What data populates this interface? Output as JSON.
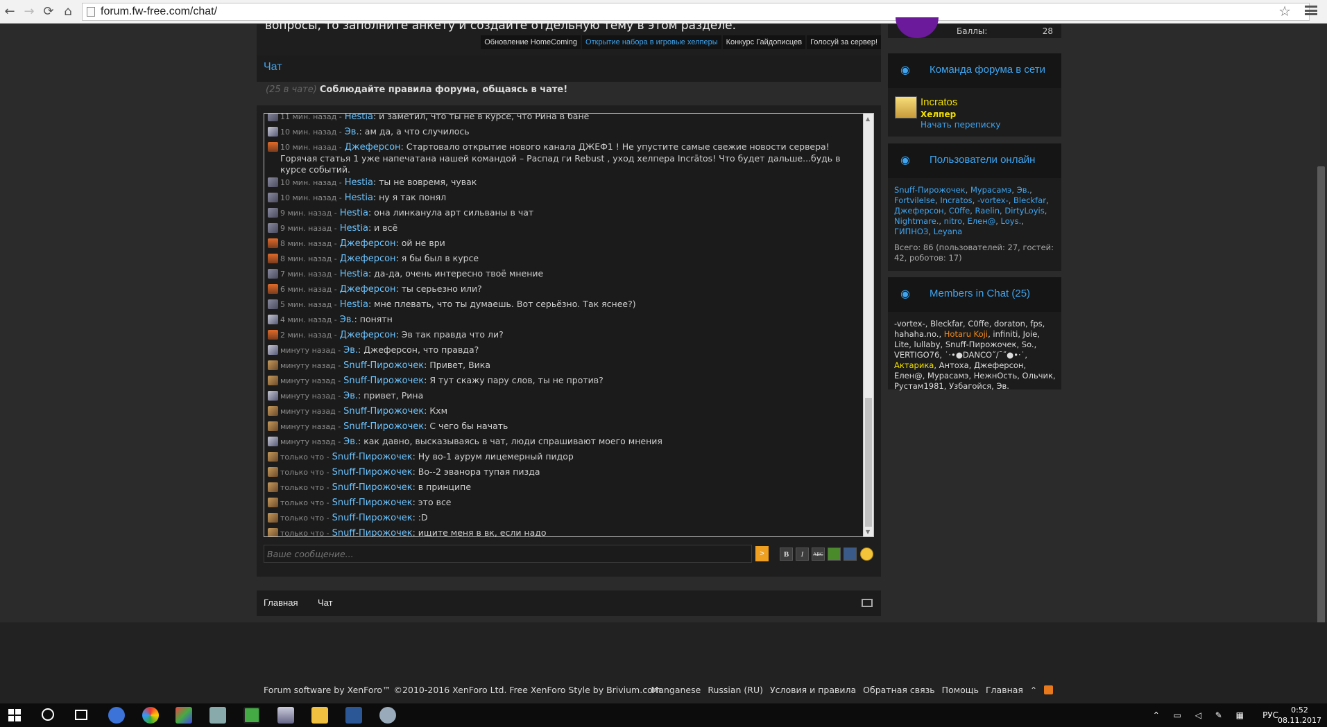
{
  "browser": {
    "url": "forum.fw-free.com/chat/"
  },
  "notices": {
    "cut_text": "вопросы, то заполните анкету и создайте отдельную тему в этом разделе.",
    "links": [
      "Обновление HomeComing",
      "Открытие набора в игровые хелперы",
      "Конкурс Гайдописцев",
      "Голосуй за сервер!"
    ]
  },
  "chat": {
    "title": "Чат",
    "count_text": "(25 в чате)",
    "rules_text": "Соблюдайте правила форума, общаясь в чате!",
    "input_placeholder": "Ваше сообщение...",
    "send_label": ">",
    "tools": [
      "B",
      "I",
      "ABC",
      "",
      "",
      ""
    ],
    "messages": [
      {
        "av": "hestia",
        "time": "11 мин. назад -",
        "author": "Hestia",
        "text": ": и заметил, что ты не в курсе, что Рина в бане"
      },
      {
        "av": "ev",
        "time": "10 мин. назад -",
        "author": "Эв.",
        "text": ": ам да, а что случилось"
      },
      {
        "av": "dj",
        "time": "10 мин. назад -",
        "author": "Джеферсон",
        "text": ": Стартовало открытие нового канала ДЖЕФ1 ! Не упустите самые свежие новости сервера! Горячая статья 1 уже напечатана нашей командой – Распад ги Rebust , уход хелпера Incrātos! Что будет дальше...будь в курсе событий."
      },
      {
        "av": "hestia",
        "time": "10 мин. назад -",
        "author": "Hestia",
        "text": ": ты не вовремя, чувак"
      },
      {
        "av": "hestia",
        "time": "10 мин. назад -",
        "author": "Hestia",
        "text": ": ну я так понял"
      },
      {
        "av": "hestia",
        "time": "9 мин. назад -",
        "author": "Hestia",
        "text": ": она линканула арт сильваны в чат"
      },
      {
        "av": "hestia",
        "time": "9 мин. назад -",
        "author": "Hestia",
        "text": ": и всё"
      },
      {
        "av": "dj",
        "time": "8 мин. назад -",
        "author": "Джеферсон",
        "text": ": ой не ври"
      },
      {
        "av": "dj",
        "time": "8 мин. назад -",
        "author": "Джеферсон",
        "text": ": я бы был в курсе"
      },
      {
        "av": "hestia",
        "time": "7 мин. назад -",
        "author": "Hestia",
        "text": ": да-да, очень интересно твоё мнение"
      },
      {
        "av": "dj",
        "time": "6 мин. назад -",
        "author": "Джеферсон",
        "text": ": ты серьезно или?"
      },
      {
        "av": "hestia",
        "time": "5 мин. назад -",
        "author": "Hestia",
        "text": ": мне плевать, что ты думаешь. Вот серьёзно. Так яснее?)"
      },
      {
        "av": "ev",
        "time": "4 мин. назад -",
        "author": "Эв.",
        "text": ": понятн"
      },
      {
        "av": "dj",
        "time": "2 мин. назад -",
        "author": "Джеферсон",
        "text": ": Эв так правда что ли?"
      },
      {
        "av": "ev",
        "time": "минуту назад -",
        "author": "Эв.",
        "text": ": Джеферсон, что правда?"
      },
      {
        "av": "sn",
        "time": "минуту назад -",
        "author": "Snuff-Пирожочек",
        "text": ": Привет, Вика"
      },
      {
        "av": "sn",
        "time": "минуту назад -",
        "author": "Snuff-Пирожочек",
        "text": ": Я тут скажу пару слов, ты не против?"
      },
      {
        "av": "ev",
        "time": "минуту назад -",
        "author": "Эв.",
        "text": ": привет, Рина"
      },
      {
        "av": "sn",
        "time": "минуту назад -",
        "author": "Snuff-Пирожочек",
        "text": ": Кхм"
      },
      {
        "av": "sn",
        "time": "минуту назад -",
        "author": "Snuff-Пирожочек",
        "text": ": С чего бы начать"
      },
      {
        "av": "ev",
        "time": "минуту назад -",
        "author": "Эв.",
        "text": ": как давно, высказываясь в чат, люди спрашивают моего мнения"
      },
      {
        "av": "sn",
        "time": "только что -",
        "author": "Snuff-Пирожочек",
        "text": ": Ну во-1 аурум лицемерный пидор"
      },
      {
        "av": "sn",
        "time": "только что -",
        "author": "Snuff-Пирожочек",
        "text": ": Во--2 эванора тупая пизда"
      },
      {
        "av": "sn",
        "time": "только что -",
        "author": "Snuff-Пирожочек",
        "text": ": в принципе"
      },
      {
        "av": "sn",
        "time": "только что -",
        "author": "Snuff-Пирожочек",
        "text": ": это все"
      },
      {
        "av": "sn",
        "time": "только что -",
        "author": "Snuff-Пирожочек",
        "text": ": :D"
      },
      {
        "av": "sn",
        "time": "только что -",
        "author": "Snuff-Пирожочек",
        "text": ": ищите меня в вк, если надо"
      }
    ]
  },
  "bottom_nav": {
    "home": "Главная",
    "chat": "Чат"
  },
  "footer": {
    "copyright": "Forum software by XenForo™ ©2010-2016 XenForo Ltd. Free XenForo Style by Brivium.com",
    "links": [
      "Manganese",
      "Russian (RU)",
      "Условия и правила",
      "Обратная связь",
      "Помощь",
      "Главная"
    ]
  },
  "sidebar": {
    "points_label": "Баллы:",
    "points_value": "28",
    "staff_title": "Команда форума в сети",
    "staff_name": "Incratos",
    "staff_role": "Хелпер",
    "staff_conv": "Начать переписку",
    "online_title": "Пользователи онлайн",
    "online_users": [
      "Snuff-Пирожочек",
      "Мурасамэ",
      "Эв.",
      "Fortvilelse",
      "Incratos",
      "-vortex-",
      "Bleckfar",
      "Джеферсон",
      "C0ffe",
      "Raelin",
      "DirtyLoyis",
      "Nightmare.",
      "nitro",
      "Елен@",
      "Loys.",
      "ГИПНОЗ",
      "Leyana"
    ],
    "online_total": "Всего: 86 (пользователей: 27, гостей: 42, роботов: 17)",
    "chat_members_title": "Members in Chat (25)",
    "chat_members": [
      {
        "n": "-vortex-",
        "c": "m"
      },
      {
        "n": "Bleckfar",
        "c": "m"
      },
      {
        "n": "C0ffe",
        "c": "m"
      },
      {
        "n": "doraton",
        "c": "m"
      },
      {
        "n": "fps",
        "c": "m"
      },
      {
        "n": "hahaha.no.",
        "c": "m"
      },
      {
        "n": "Hotaru Koji",
        "c": "orange"
      },
      {
        "n": "infiniti",
        "c": "m"
      },
      {
        "n": "Joie",
        "c": "m"
      },
      {
        "n": "Lite",
        "c": "m"
      },
      {
        "n": "lullaby",
        "c": "m"
      },
      {
        "n": "Snuff-Пирожочек",
        "c": "m"
      },
      {
        "n": "So.",
        "c": "m"
      },
      {
        "n": "VERTIGO76",
        "c": "m"
      },
      {
        "n": "˙·•●DANCO˝/¯˝●•·˙",
        "c": "m"
      },
      {
        "n": "Актарика",
        "c": "yellow"
      },
      {
        "n": "Антоха",
        "c": "m"
      },
      {
        "n": "Джеферсон",
        "c": "m"
      },
      {
        "n": "Елен@",
        "c": "m"
      },
      {
        "n": "Мурасамэ",
        "c": "m"
      },
      {
        "n": "НежнОсть",
        "c": "m"
      },
      {
        "n": "Ольчик",
        "c": "m"
      },
      {
        "n": "Рустам1981",
        "c": "m"
      },
      {
        "n": "Узбагойся",
        "c": "m"
      },
      {
        "n": "Эв.",
        "c": "m"
      }
    ]
  },
  "taskbar": {
    "lang": "РУС",
    "time": "0:52",
    "date": "08.11.2017"
  }
}
